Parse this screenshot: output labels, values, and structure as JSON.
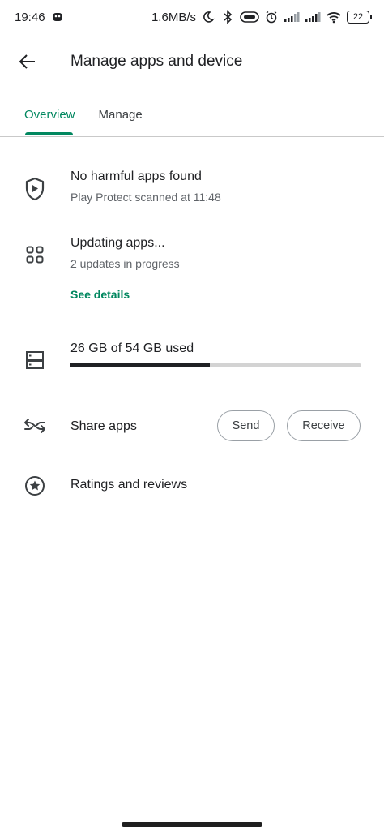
{
  "status_bar": {
    "time": "19:46",
    "speed": "1.6MB/s",
    "battery": "22",
    "icons": [
      "notification-icon",
      "moon-icon",
      "bluetooth-icon",
      "vibrate-icon",
      "alarm-icon",
      "signal-icon",
      "signal-icon",
      "wifi-icon",
      "battery-icon"
    ]
  },
  "app_bar": {
    "title": "Manage apps and device"
  },
  "tabs": [
    {
      "label": "Overview",
      "active": true
    },
    {
      "label": "Manage",
      "active": false
    }
  ],
  "protect": {
    "title": "No harmful apps found",
    "subtitle": "Play Protect scanned at 11:48"
  },
  "updates": {
    "title": "Updating apps...",
    "subtitle": "2 updates in progress",
    "link": "See details"
  },
  "storage": {
    "label": "26 GB of 54 GB used",
    "used_fraction": 0.4815
  },
  "share": {
    "label": "Share apps",
    "send": "Send",
    "receive": "Receive"
  },
  "ratings": {
    "label": "Ratings and reviews"
  },
  "colors": {
    "accent": "#01875f",
    "text": "#202124",
    "secondary": "#5f6368"
  }
}
